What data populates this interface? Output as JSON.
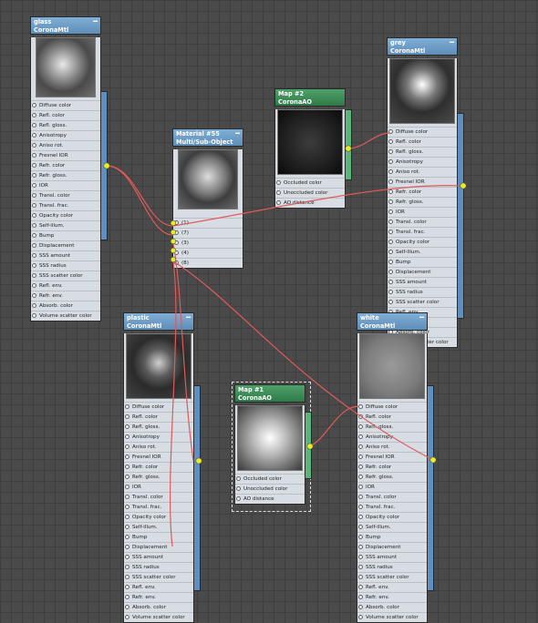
{
  "nodes": {
    "glass": {
      "title": "glass",
      "type": "CoronaMtl"
    },
    "mat55": {
      "title": "Material #55",
      "type": "Multi/Sub-Object",
      "slots": [
        "(1)",
        "(7)",
        "(3)",
        "(4)",
        "(8)"
      ]
    },
    "map2": {
      "title": "Map #2",
      "type": "CoronaAO"
    },
    "grey": {
      "title": "grey",
      "type": "CoronaMtl"
    },
    "plastic": {
      "title": "plastic",
      "type": "CoronaMtl"
    },
    "map1": {
      "title": "Map #1",
      "type": "CoronaAO"
    },
    "white": {
      "title": "white",
      "type": "CoronaMtl"
    }
  },
  "mtl_slots": [
    "Diffuse color",
    "Refl. color",
    "Refl. gloss.",
    "Anisotropy",
    "Aniso rot.",
    "Fresnel IOR",
    "Refr. color",
    "Refr. gloss.",
    "IOR",
    "Transl. color",
    "Transl. frac.",
    "Opacity color",
    "Self-illum.",
    "Bump",
    "Displacement",
    "SSS amount",
    "SSS radius",
    "SSS scatter color",
    "Refl. env.",
    "Refr. env.",
    "Absorb. color",
    "Volume scatter color"
  ],
  "ao_slots": [
    "Occluded color",
    "Unoccluded color",
    "AO distance"
  ],
  "minimize_glyph": "━",
  "colors": {
    "material_header": "#6f9ec9",
    "map_header": "#3f8f5a",
    "wire": "#e05a5a",
    "port": "#e8ef1c"
  }
}
